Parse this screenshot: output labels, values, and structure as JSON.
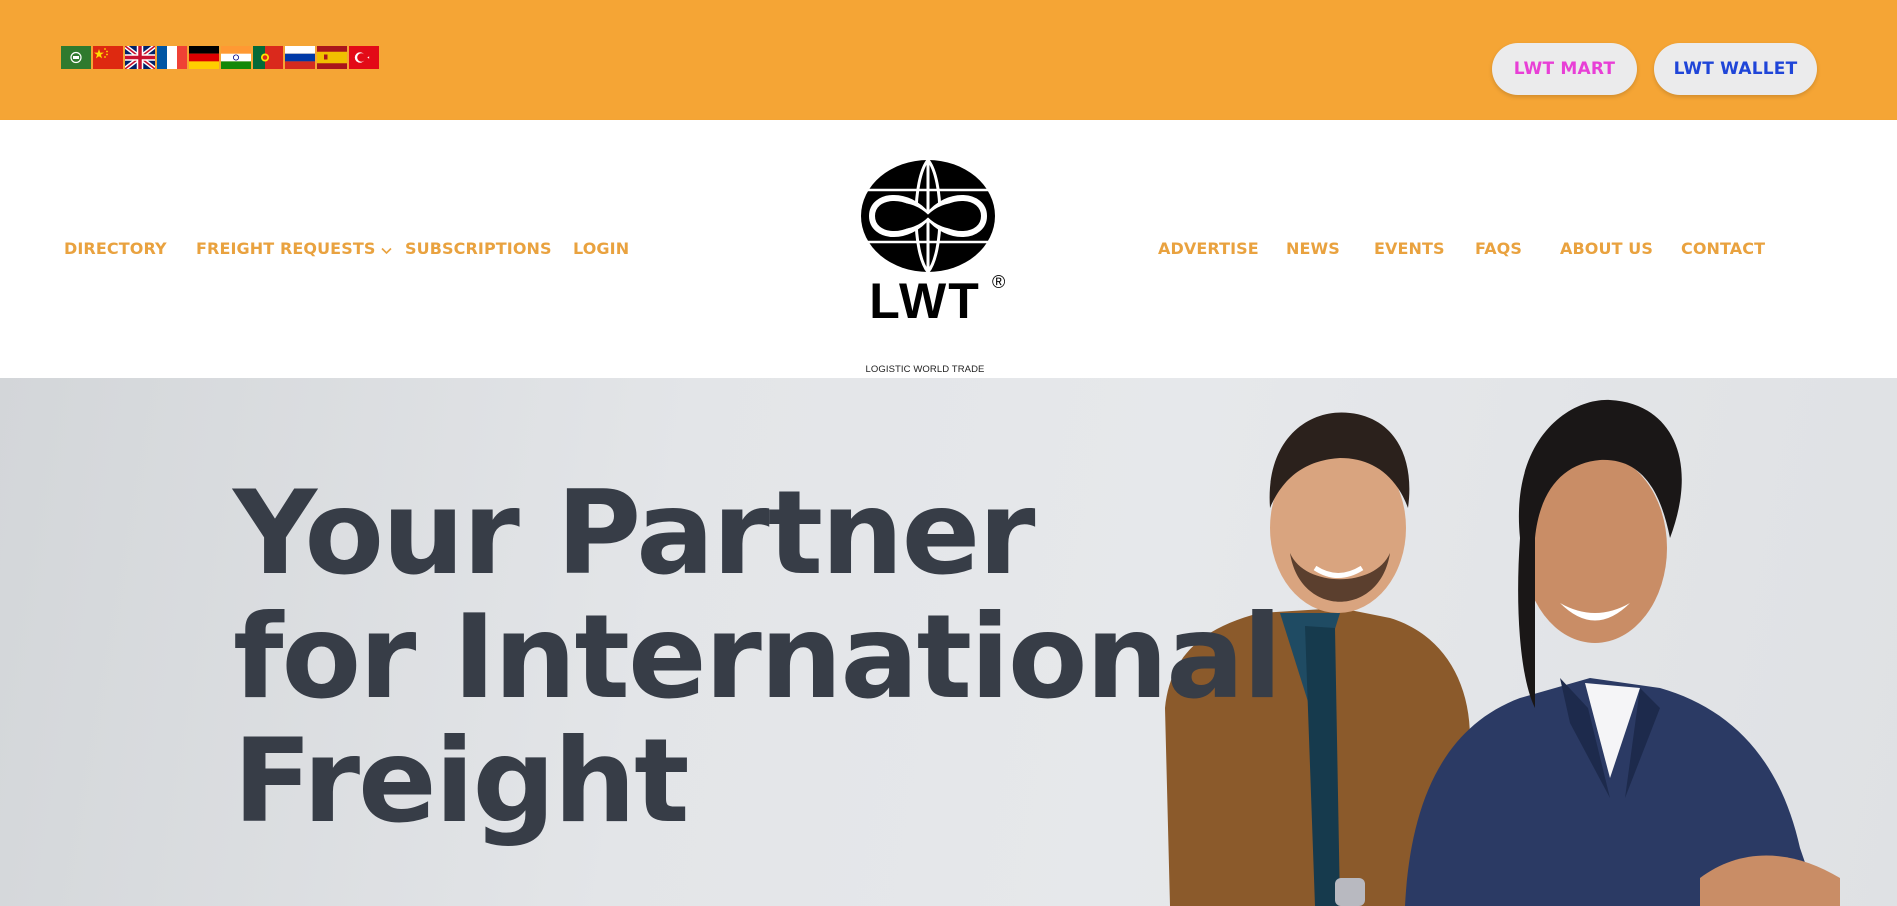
{
  "topbar": {
    "background": "#f5a535",
    "languages": [
      {
        "name": "Arabic",
        "icon": "flag-arabic-icon"
      },
      {
        "name": "Chinese",
        "icon": "flag-china-icon"
      },
      {
        "name": "English",
        "icon": "flag-uk-icon"
      },
      {
        "name": "French",
        "icon": "flag-france-icon"
      },
      {
        "name": "German",
        "icon": "flag-germany-icon"
      },
      {
        "name": "Hindi",
        "icon": "flag-india-icon"
      },
      {
        "name": "Portuguese",
        "icon": "flag-portugal-icon"
      },
      {
        "name": "Russian",
        "icon": "flag-russia-icon"
      },
      {
        "name": "Spanish",
        "icon": "flag-spain-icon"
      },
      {
        "name": "Turkish",
        "icon": "flag-turkey-icon"
      }
    ],
    "buttons": {
      "mart_label": "LWT MART",
      "wallet_label": "LWT WALLET"
    }
  },
  "nav": {
    "left": [
      {
        "label": "DIRECTORY"
      },
      {
        "label": "FREIGHT REQUESTS"
      },
      {
        "label": "SUBSCRIPTIONS"
      },
      {
        "label": "LOGIN"
      }
    ],
    "right": [
      {
        "label": "ADVERTISE"
      },
      {
        "label": "NEWS"
      },
      {
        "label": "EVENTS"
      },
      {
        "label": "FAQS"
      },
      {
        "label": "ABOUT US"
      },
      {
        "label": "CONTACT"
      }
    ],
    "logo": {
      "text": "LWT",
      "registered": "®",
      "subtitle": "LOGISTIC WORLD TRADE"
    },
    "accent": "#e9a23f"
  },
  "hero": {
    "heading_lines": [
      "Your Partner",
      "for International",
      "Freight"
    ],
    "heading_color": "#373d47"
  }
}
